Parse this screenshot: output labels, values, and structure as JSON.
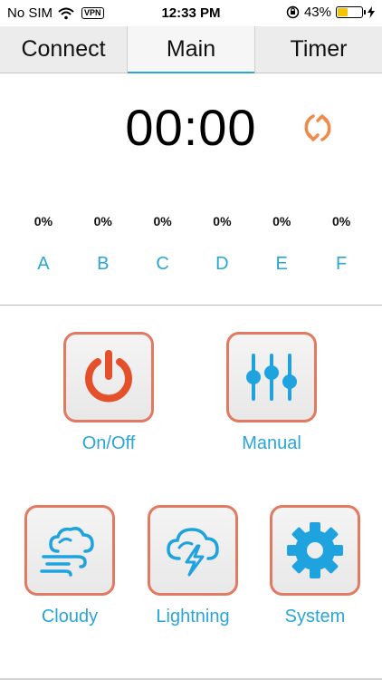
{
  "status_bar": {
    "carrier": "No SIM",
    "vpn": "VPN",
    "time": "12:33 PM",
    "battery": "43%",
    "battery_level": 0.43
  },
  "tabs": [
    {
      "label": "Connect",
      "active": false
    },
    {
      "label": "Main",
      "active": true
    },
    {
      "label": "Timer",
      "active": false
    }
  ],
  "timer": {
    "value": "00:00"
  },
  "channels": [
    {
      "percent": "0%",
      "label": "A"
    },
    {
      "percent": "0%",
      "label": "B"
    },
    {
      "percent": "0%",
      "label": "C"
    },
    {
      "percent": "0%",
      "label": "D"
    },
    {
      "percent": "0%",
      "label": "E"
    },
    {
      "percent": "0%",
      "label": "F"
    }
  ],
  "buttons": {
    "onoff": "On/Off",
    "manual": "Manual",
    "cloudy": "Cloudy",
    "lightning": "Lightning",
    "system": "System"
  },
  "colors": {
    "accent_blue": "#2aa6d6",
    "power_red": "#e4502a",
    "refresh_orange": "#f08a4b",
    "button_border": "#e27961",
    "icon_blue": "#1fa3df"
  },
  "icons": {
    "refresh": "refresh-icon",
    "power": "power-icon",
    "sliders": "sliders-icon",
    "cloudy": "cloud-wind-icon",
    "lightning": "cloud-lightning-icon",
    "system": "gear-icon"
  }
}
